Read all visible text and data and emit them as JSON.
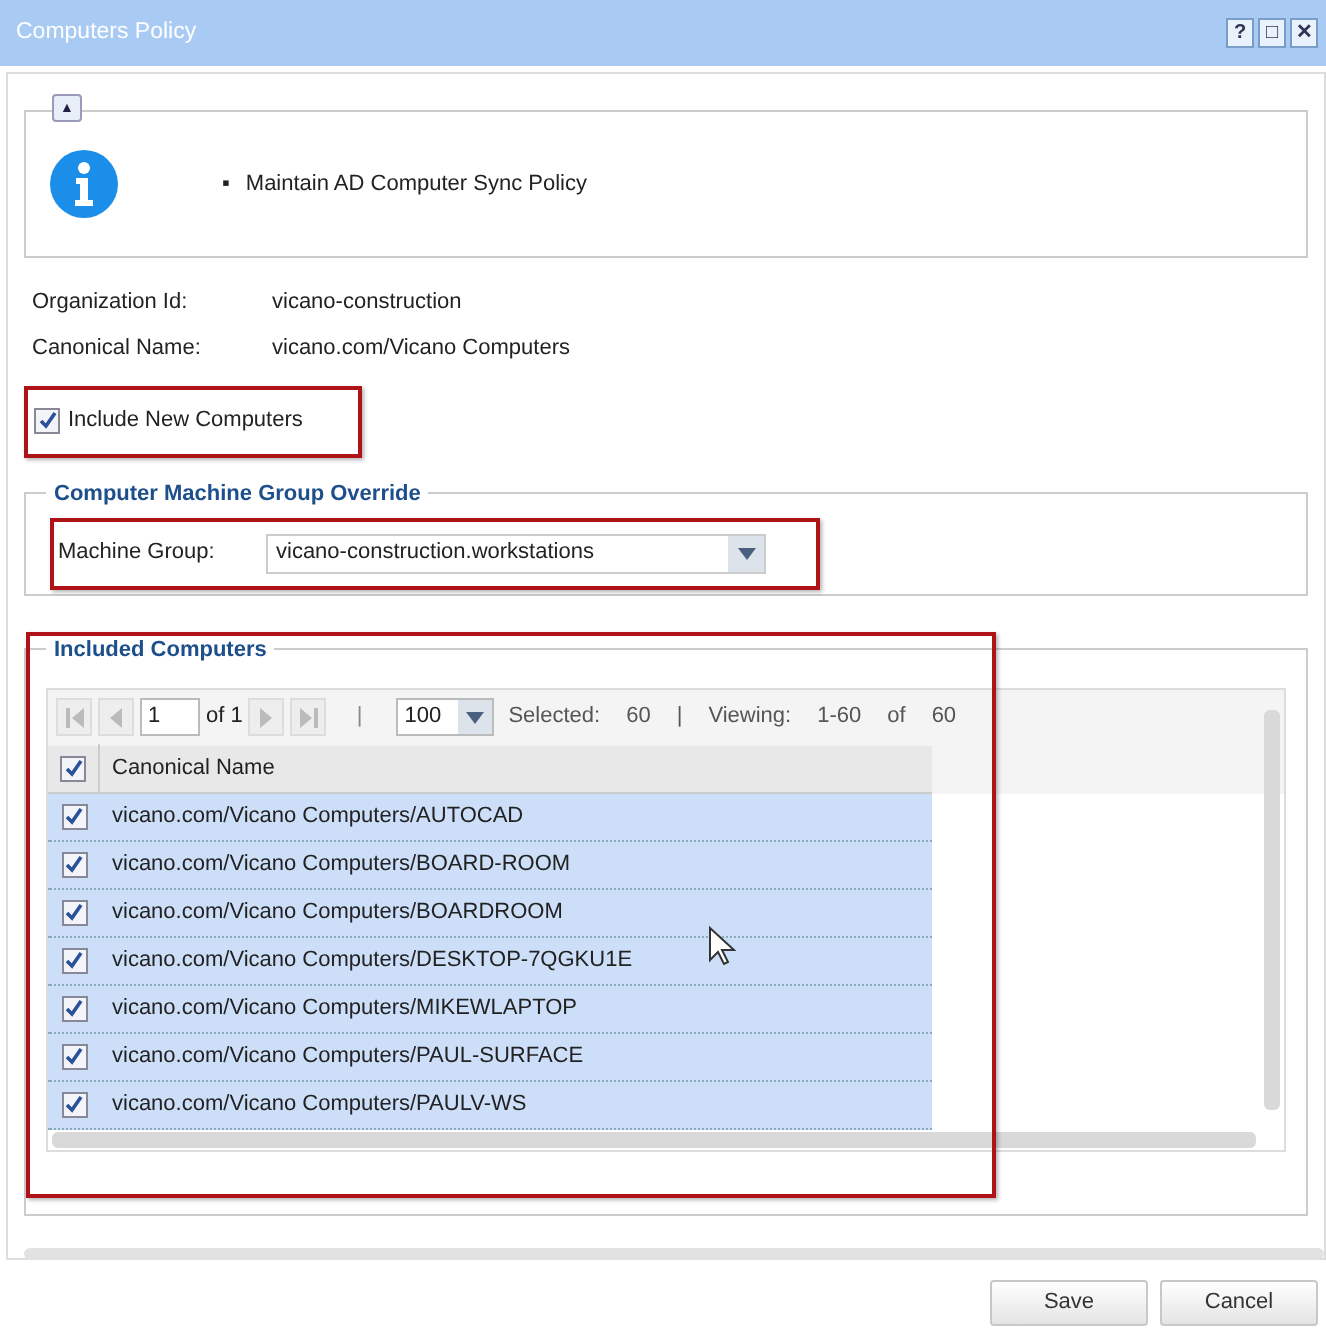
{
  "window": {
    "title": "Computers Policy",
    "controls": [
      "?",
      "□",
      "✕"
    ]
  },
  "info": {
    "collapse_button": "▲",
    "bullet": "▪",
    "items": [
      "Maintain AD Computer Sync Policy"
    ]
  },
  "fields": [
    {
      "label": "Organization Id:",
      "value": "vicano-construction"
    },
    {
      "label": "Canonical Name:",
      "value": "vicano.com/Vicano Computers"
    }
  ],
  "include_new": {
    "label": "Include New Computers",
    "checked": true,
    "highlighted": true
  },
  "machine_group": {
    "legend": "Computer Machine Group Override",
    "label": "Machine Group:",
    "value": "vicano-construction.workstations",
    "highlighted": true
  },
  "included": {
    "legend": "Included Computers",
    "highlighted": true,
    "pager": {
      "page": "1",
      "of": "of 1",
      "separator": "|",
      "page_size": "100",
      "selected_label": "Selected:",
      "selected": "60",
      "separator2": "|",
      "viewing_label": "Viewing:",
      "viewing": "1-60",
      "of_label": "of",
      "total": "60"
    },
    "header": {
      "label": "Canonical Name",
      "checked": true
    },
    "rows": [
      {
        "name": "vicano.com/Vicano Computers/AUTOCAD",
        "checked": true,
        "selected": true
      },
      {
        "name": "vicano.com/Vicano Computers/BOARD-ROOM",
        "checked": true,
        "selected": true
      },
      {
        "name": "vicano.com/Vicano Computers/BOARDROOM",
        "checked": true,
        "selected": true
      },
      {
        "name": "vicano.com/Vicano Computers/DESKTOP-7QGKU1E",
        "checked": true,
        "selected": true
      },
      {
        "name": "vicano.com/Vicano Computers/MIKEWLAPTOP",
        "checked": true,
        "selected": true
      },
      {
        "name": "vicano.com/Vicano Computers/PAUL-SURFACE",
        "checked": true,
        "selected": true
      },
      {
        "name": "vicano.com/Vicano Computers/PAULV-WS",
        "checked": true,
        "selected": true
      }
    ]
  },
  "buttons": [
    "Save",
    "Cancel"
  ]
}
